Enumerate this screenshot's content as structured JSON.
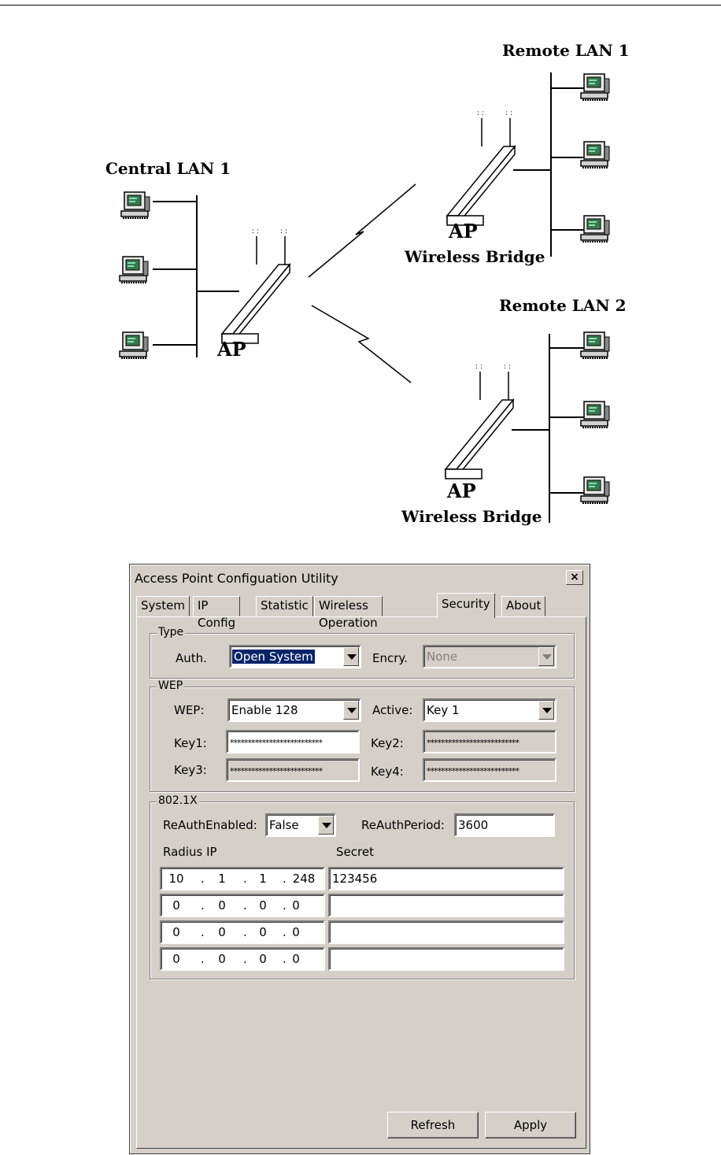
{
  "diagram": {
    "central_title": "Central LAN 1",
    "central_ap": "AP",
    "remote1_title": "Remote LAN 1",
    "remote1_ap": "AP",
    "remote1_bridge": "Wireless Bridge",
    "remote2_title": "Remote LAN 2",
    "remote2_ap": "AP",
    "remote2_bridge": "Wireless Bridge"
  },
  "dialog": {
    "title": "Access Point Configuation Utility",
    "close_label": "×",
    "tabs": [
      "System",
      "IP Config",
      "Statistic",
      "Wireless Operation",
      "Security",
      "About"
    ],
    "active_tab": "Security",
    "type_group": {
      "legend": "Type",
      "auth_label": "Auth.",
      "auth_value": "Open System",
      "encry_label": "Encry.",
      "encry_value": "None"
    },
    "wep_group": {
      "legend": "WEP",
      "wep_label": "WEP:",
      "wep_value": "Enable 128",
      "active_label": "Active:",
      "active_value": "Key 1",
      "key1_label": "Key1:",
      "key1_value": "**************************",
      "key2_label": "Key2:",
      "key2_value": "**************************",
      "key3_label": "Key3:",
      "key3_value": "**************************",
      "key4_label": "Key4:",
      "key4_value": "**************************"
    },
    "dot1x_group": {
      "legend": "802.1X",
      "reauth_enabled_label": "ReAuthEnabled:",
      "reauth_enabled_value": "False",
      "reauth_period_label": "ReAuthPeriod:",
      "reauth_period_value": "3600",
      "radius_ip_header": "Radius IP",
      "secret_header": "Secret",
      "rows": [
        {
          "ip": [
            "10",
            "1",
            "1",
            "248"
          ],
          "secret": "123456"
        },
        {
          "ip": [
            "0",
            "0",
            "0",
            "0"
          ],
          "secret": ""
        },
        {
          "ip": [
            "0",
            "0",
            "0",
            "0"
          ],
          "secret": ""
        },
        {
          "ip": [
            "0",
            "0",
            "0",
            "0"
          ],
          "secret": ""
        }
      ]
    },
    "refresh_label": "Refresh",
    "apply_label": "Apply"
  }
}
